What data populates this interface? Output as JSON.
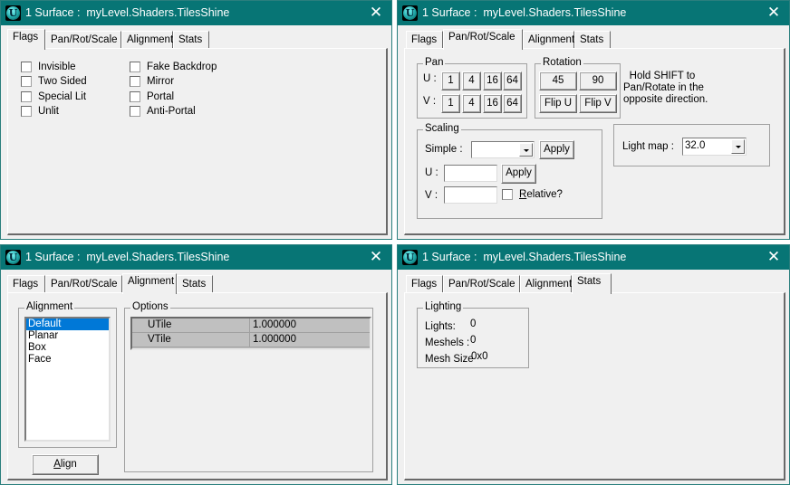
{
  "window_title": "1 Surface :  myLevel.Shaders.TilesShine",
  "close_glyph": "✕",
  "tabs": [
    "Flags",
    "Pan/Rot/Scale",
    "Alignment",
    "Stats"
  ],
  "windows": {
    "flags": {
      "active_tab": "Flags",
      "left_column": [
        {
          "label": "Invisible",
          "checked": false
        },
        {
          "label": "Two Sided",
          "checked": false
        },
        {
          "label": "Special Lit",
          "checked": false
        },
        {
          "label": "Unlit",
          "checked": false
        }
      ],
      "right_column": [
        {
          "label": "Fake Backdrop",
          "checked": false
        },
        {
          "label": "Mirror",
          "checked": false
        },
        {
          "label": "Portal",
          "checked": false
        },
        {
          "label": "Anti-Portal",
          "checked": false
        }
      ]
    },
    "pan_rot_scale": {
      "active_tab": "Pan/Rot/Scale",
      "pan": {
        "legend": "Pan",
        "u_label": "U :",
        "v_label": "V :",
        "steps": [
          "1",
          "4",
          "16",
          "64"
        ]
      },
      "rotation": {
        "legend": "Rotation",
        "buttons": [
          "45",
          "90",
          "Flip U",
          "Flip V"
        ]
      },
      "hint": [
        "Hold SHIFT to",
        "Pan/Rotate in the",
        "opposite direction."
      ],
      "scaling": {
        "legend": "Scaling",
        "simple_label": "Simple :",
        "simple_value": "",
        "apply_label": "Apply",
        "u_label": "U :",
        "u_value": "",
        "v_label": "V :",
        "v_value": "",
        "relative_label_accel": "R",
        "relative_label_rest": "elative?",
        "relative_checked": false
      },
      "lightmap": {
        "label": "Light map :",
        "value": "32.0"
      }
    },
    "alignment": {
      "active_tab": "Alignment",
      "list_legend": "Alignment",
      "items": [
        "Default",
        "Planar",
        "Box",
        "Face"
      ],
      "selected": "Default",
      "align_button_accel": "A",
      "align_button_rest": "lign",
      "options_legend": "Options",
      "options": [
        {
          "key": "UTile",
          "value": "1.000000"
        },
        {
          "key": "VTile",
          "value": "1.000000"
        }
      ]
    },
    "stats": {
      "active_tab": "Stats",
      "legend": "Lighting",
      "rows": [
        {
          "label": "Lights:",
          "value": "0"
        },
        {
          "label": "Meshels :",
          "value": "0"
        },
        {
          "label": "Mesh Size",
          "value": "0x0"
        }
      ]
    }
  }
}
